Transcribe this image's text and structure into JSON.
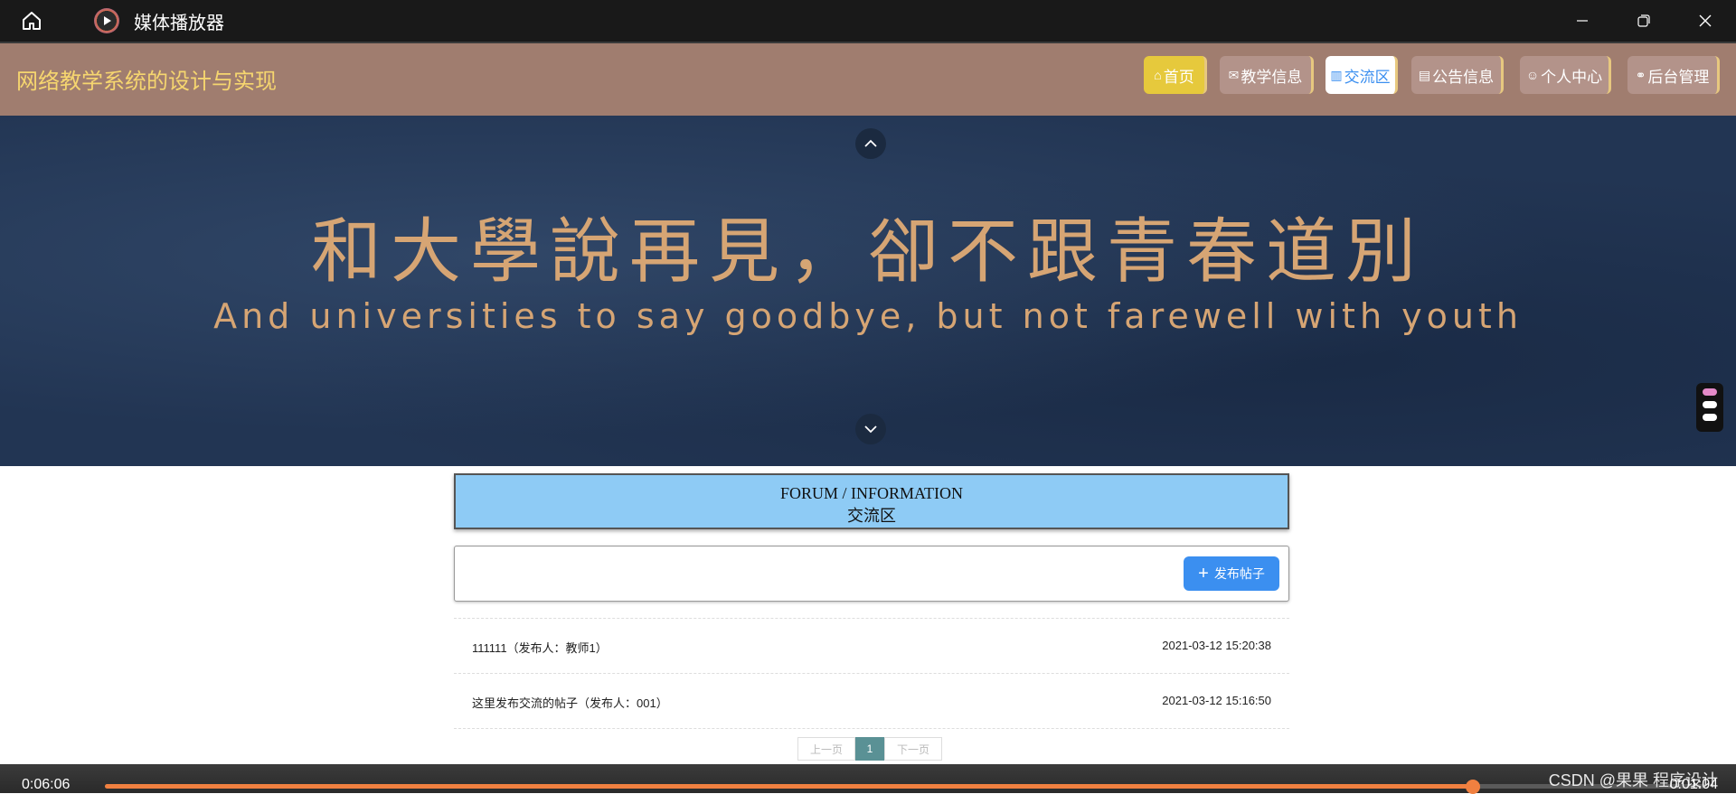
{
  "titlebar": {
    "title": "媒体播放器"
  },
  "navbar": {
    "site_title": "网络教学系统的设计与实现",
    "items": [
      {
        "icon": "home-icon",
        "label": "首页",
        "bg": "#e6c93c",
        "color": "#ffffff"
      },
      {
        "icon": "mail-icon",
        "label": "教学信息",
        "bg": "#b3938a",
        "color": "#ffffff"
      },
      {
        "icon": "forum-icon",
        "label": "交流区",
        "bg": "#ffffff",
        "color": "#3b8ff0"
      },
      {
        "icon": "notice-icon",
        "label": "公告信息",
        "bg": "#b3938a",
        "color": "#ffffff"
      },
      {
        "icon": "user-icon",
        "label": "个人中心",
        "bg": "#b3938a",
        "color": "#ffffff"
      },
      {
        "icon": "link-icon",
        "label": "后台管理",
        "bg": "#b3938a",
        "color": "#ffffff"
      }
    ]
  },
  "banner": {
    "cn": "和大學說再見，卻不跟青春道別",
    "en": "And universities to say goodbye, but not farewell with youth"
  },
  "forum": {
    "header_en": "FORUM / INFORMATION",
    "header_cn": "交流区",
    "post_button": "发布帖子",
    "posts": [
      {
        "title": "111111（发布人：教师1）",
        "date": "2021-03-12 15:20:38"
      },
      {
        "title": "这里发布交流的帖子（发布人：001）",
        "date": "2021-03-12 15:16:50"
      }
    ]
  },
  "pagination": {
    "prev": "上一页",
    "current": "1",
    "next": "下一页"
  },
  "player": {
    "elapsed": "0:06:06",
    "remaining": "0:01:04",
    "progress_percent": 85.5,
    "watermark": "CSDN @果果 程序设计"
  },
  "colors": {
    "accent": "#3b8ff0",
    "nav_bg": "#a07d6f",
    "banner_text": "#d6a574",
    "progress": "#f08040"
  }
}
